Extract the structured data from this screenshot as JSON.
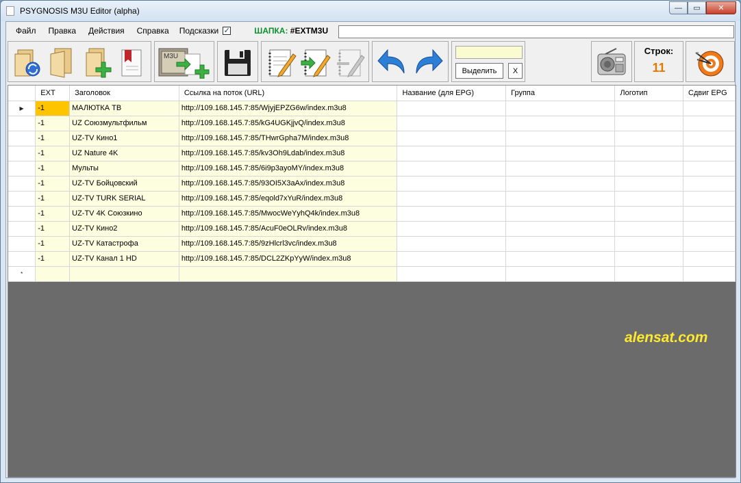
{
  "window": {
    "title": "PSYGNOSIS M3U Editor (alpha)",
    "buttons": {
      "minimize": "—",
      "maximize": "▭",
      "close": "✕"
    }
  },
  "menu": {
    "items": [
      "Файл",
      "Правка",
      "Действия",
      "Справка"
    ],
    "hints_label": "Подсказки",
    "hints_checked": "✓",
    "header_label": "ШАПКА:",
    "header_value": "#EXTM3U"
  },
  "toolbar": {
    "select_button": "Выделить",
    "clear_button": "X",
    "rows_label": "Строк:",
    "rows_count": "11",
    "m3u_badge": "M3U",
    "icons": [
      "refresh-open-icon",
      "open-folder-icon",
      "add-file-icon",
      "bookmark-icon",
      "m3u-import-icon",
      "save-icon",
      "edit-notes-icon",
      "insert-notes-icon",
      "remove-notes-icon",
      "undo-icon",
      "redo-icon",
      "radio-icon",
      "target-icon"
    ]
  },
  "table": {
    "columns": [
      "EXT",
      "Заголовок",
      "Ссылка на поток (URL)",
      "Название (для EPG)",
      "Группа",
      "Логотип",
      "Сдвиг EPG"
    ],
    "rows": [
      [
        "-1",
        "МАЛЮТКА ТВ",
        "http://109.168.145.7:85/WjyjEPZG6w/index.m3u8",
        "",
        "",
        "",
        ""
      ],
      [
        "-1",
        "UZ Союзмультфильм",
        "http://109.168.145.7:85/kG4UGKjjvQ/index.m3u8",
        "",
        "",
        "",
        ""
      ],
      [
        "-1",
        "UZ-TV Кино1",
        "http://109.168.145.7:85/THwrGpha7M/index.m3u8",
        "",
        "",
        "",
        ""
      ],
      [
        "-1",
        "UZ Nature 4K",
        "http://109.168.145.7:85/kv3Oh9Ldab/index.m3u8",
        "",
        "",
        "",
        ""
      ],
      [
        "-1",
        "Мульты",
        "http://109.168.145.7:85/6i9p3ayoMY/index.m3u8",
        "",
        "",
        "",
        ""
      ],
      [
        "-1",
        "UZ-TV Бойцовский",
        "http://109.168.145.7:85/93OI5X3aAx/index.m3u8",
        "",
        "",
        "",
        ""
      ],
      [
        "-1",
        "UZ-TV TURK SERIAL",
        "http://109.168.145.7:85/eqold7xYuR/index.m3u8",
        "",
        "",
        "",
        ""
      ],
      [
        "-1",
        "UZ-TV 4K Союзкино",
        "http://109.168.145.7:85/MwocWeYyhQ4k/index.m3u8",
        "",
        "",
        "",
        ""
      ],
      [
        "-1",
        "UZ-TV Кино2",
        "http://109.168.145.7:85/AcuF0eOLRv/index.m3u8",
        "",
        "",
        "",
        ""
      ],
      [
        "-1",
        "UZ-TV Катастрофа",
        "http://109.168.145.7:85/9zHlcrl3vc/index.m3u8",
        "",
        "",
        "",
        ""
      ],
      [
        "-1",
        "UZ-TV Канал 1 HD",
        "http://109.168.145.7:85/DCL2ZKpYyW/index.m3u8",
        "",
        "",
        "",
        ""
      ]
    ],
    "current_row_marker": "▶",
    "new_row_marker": "*"
  },
  "watermark": "alensat.com",
  "colors": {
    "accent_green": "#0a8f2e",
    "count_orange": "#e07b00",
    "cell_yellow": "#fdfde0",
    "selected_cell": "#ffc400",
    "grid_background": "#6b6b6b",
    "watermark_yellow": "#ffe92e"
  }
}
